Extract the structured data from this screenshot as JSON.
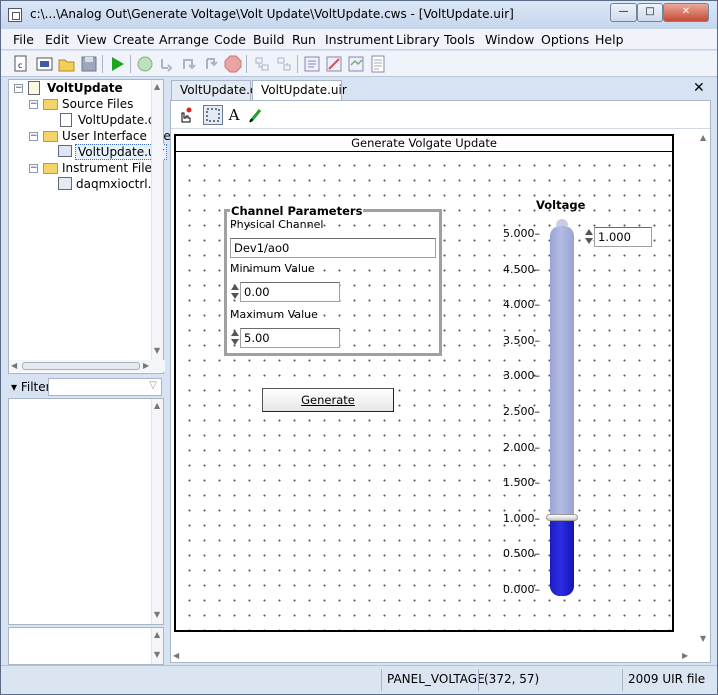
{
  "window": {
    "title": "c:\\...\\Analog Out\\Generate Voltage\\Volt Update\\VoltUpdate.cws - [VoltUpdate.uir]"
  },
  "menu": [
    "File",
    "Edit",
    "View",
    "Create",
    "Arrange",
    "Code",
    "Build",
    "Run",
    "Instrument",
    "Library",
    "Tools",
    "Window",
    "Options",
    "Help"
  ],
  "toolbar": {
    "icons": [
      "new-c-file-icon",
      "new-uir-icon",
      "open-folder-icon",
      "save-icon",
      "run-icon",
      "go-icon",
      "step-into-icon",
      "step-over-icon",
      "finish-icon",
      "stop-icon",
      "toggle-breakpoint-icon",
      "breakpoint-list-icon",
      "function-panel-icon",
      "edit-panel-icon",
      "view-panel-icon",
      "help-document-icon"
    ]
  },
  "tree": {
    "project": "VoltUpdate",
    "source_folder": "Source Files",
    "source_file": "VoltUpdate.c",
    "ui_folder": "User Interface Files",
    "ui_file": "VoltUpdate.uir",
    "instr_folder": "Instrument Files",
    "instr_file": "daqmxioctrl.fp"
  },
  "filter": {
    "label": "Filter",
    "value": ""
  },
  "tabs": [
    {
      "label": "VoltUpdate.c",
      "active": false
    },
    {
      "label": "VoltUpdate.uir",
      "active": true
    }
  ],
  "editor_tools": [
    "operate-tool-icon",
    "select-tool-icon",
    "label-tool-icon",
    "color-tool-icon"
  ],
  "panel": {
    "title": "Generate Volgate Update",
    "channel_group": {
      "title": "Channel Parameters",
      "physical_channel_label": "Physical Channel",
      "physical_channel_value": "Dev1/ao0",
      "min_label": "Minimum Value",
      "min_value": "0.00",
      "max_label": "Maximum Value",
      "max_value": "5.00"
    },
    "generate_button": "Generate",
    "voltage": {
      "label": "Voltage",
      "ticks": [
        "5.000",
        "4.500",
        "4.000",
        "3.500",
        "3.000",
        "2.500",
        "2.000",
        "1.500",
        "1.000",
        "0.500",
        "0.000"
      ],
      "value_display": "1.000",
      "level_fraction": 0.2,
      "fill_color": "#2a2ad8",
      "empty_color": "#9aa3d4"
    }
  },
  "status": {
    "panel": "PANEL_VOLTAGE",
    "coords": "(372, 57)",
    "filetype": "2009 UIR file"
  }
}
